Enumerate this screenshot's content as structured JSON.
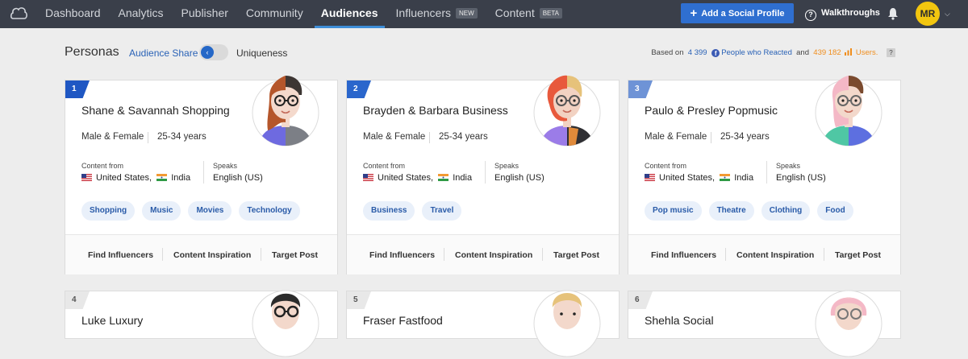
{
  "nav": {
    "items": [
      {
        "label": "Dashboard"
      },
      {
        "label": "Analytics"
      },
      {
        "label": "Publisher"
      },
      {
        "label": "Community"
      },
      {
        "label": "Audiences",
        "active": true
      },
      {
        "label": "Influencers",
        "badge": "NEW"
      },
      {
        "label": "Content",
        "badge": "BETA"
      }
    ],
    "add_profile_label": "Add a Social Profile",
    "walkthroughs_label": "Walkthroughs",
    "user_initials": "MR"
  },
  "subheader": {
    "title": "Personas",
    "audience_share_label": "Audience Share",
    "uniqueness_label": "Uniqueness",
    "based_on_label": "Based on",
    "fb_count": "4 399",
    "fb_label": "People who Reacted",
    "and_label": "and",
    "users_count": "439 182",
    "users_label": "Users.",
    "help_label": "?"
  },
  "labels": {
    "content_from": "Content from",
    "speaks": "Speaks",
    "find_influencers": "Find Influencers",
    "content_inspiration": "Content Inspiration",
    "target_post": "Target Post"
  },
  "cards": [
    {
      "rank": "1",
      "name": "Shane & Savannah Shopping",
      "gender": "Male & Female",
      "age": "25-34 years",
      "countries": [
        "United States,",
        "India"
      ],
      "language": "English (US)",
      "tags": [
        "Shopping",
        "Music",
        "Movies",
        "Technology"
      ],
      "rank_color": "#1f57c3"
    },
    {
      "rank": "2",
      "name": "Brayden & Barbara Business",
      "gender": "Male & Female",
      "age": "25-34 years",
      "countries": [
        "United States,",
        "India"
      ],
      "language": "English (US)",
      "tags": [
        "Business",
        "Travel"
      ],
      "rank_color": "#2a66cc"
    },
    {
      "rank": "3",
      "name": "Paulo & Presley Popmusic",
      "gender": "Male & Female",
      "age": "25-34 years",
      "countries": [
        "United States,",
        "India"
      ],
      "language": "English (US)",
      "tags": [
        "Pop music",
        "Theatre",
        "Clothing",
        "Food"
      ],
      "rank_color": "#6e93d6"
    },
    {
      "rank": "4",
      "name": "Luke Luxury"
    },
    {
      "rank": "5",
      "name": "Fraser Fastfood"
    },
    {
      "rank": "6",
      "name": "Shehla Social"
    }
  ]
}
